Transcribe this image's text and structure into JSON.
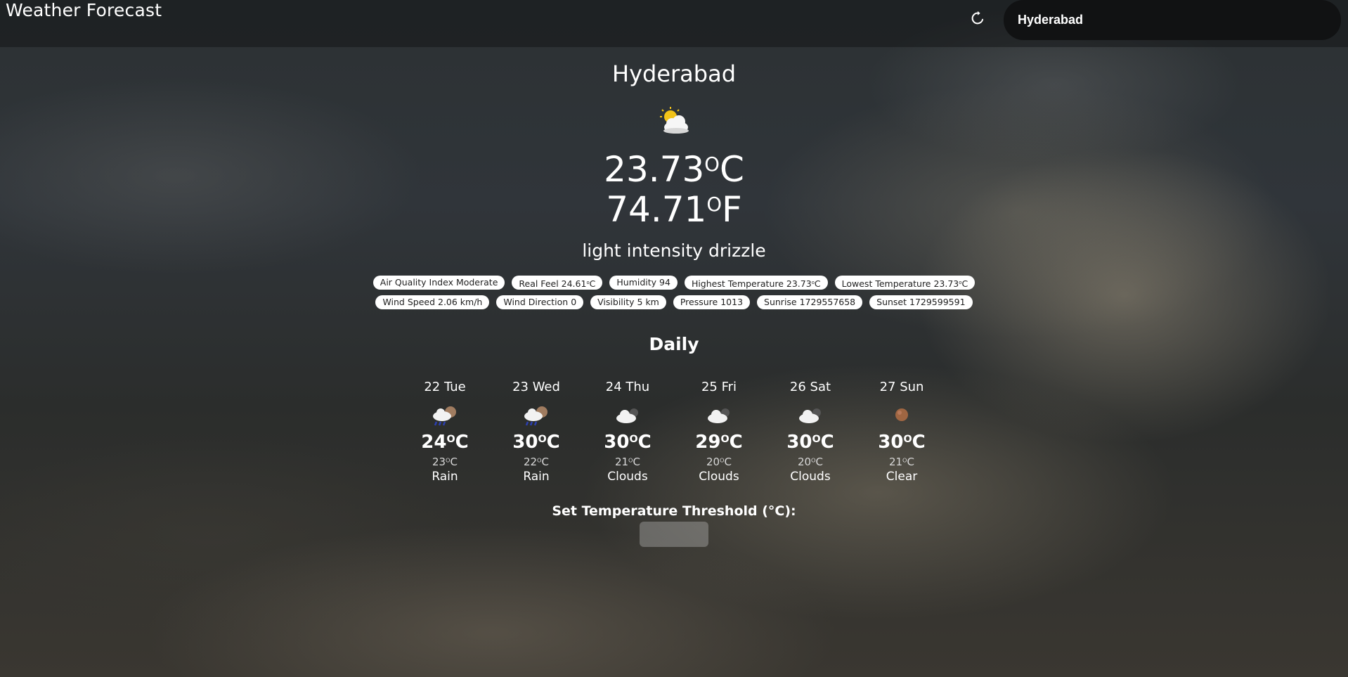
{
  "header": {
    "title": "Weather Forecast",
    "refresh_icon": "refresh-icon",
    "search_value": "Hyderabad"
  },
  "current": {
    "city": "Hyderabad",
    "icon": "partly-cloudy-sun-icon",
    "temp_c": "23.73",
    "temp_f": "74.71",
    "unit_c": "C",
    "unit_f": "F",
    "description": "light intensity drizzle"
  },
  "details_row1": [
    {
      "label": "Air Quality Index Moderate"
    },
    {
      "label": "Real Feel 24.61",
      "unit": "C"
    },
    {
      "label": "Humidity 94"
    },
    {
      "label": "Highest Temperature 23.73",
      "unit": "C"
    },
    {
      "label": "Lowest Temperature 23.73",
      "unit": "C"
    }
  ],
  "details_row2": [
    {
      "label": "Wind Speed 2.06 km/h"
    },
    {
      "label": "Wind Direction 0"
    },
    {
      "label": "Visibility 5 km"
    },
    {
      "label": "Pressure 1013"
    },
    {
      "label": "Sunrise 1729557658"
    },
    {
      "label": "Sunset 1729599591"
    }
  ],
  "daily": {
    "title": "Daily",
    "days": [
      {
        "name": "22 Tue",
        "icon": "rain-night-icon",
        "max": "24",
        "min": "23",
        "condition": "Rain"
      },
      {
        "name": "23 Wed",
        "icon": "rain-night-icon",
        "max": "30",
        "min": "22",
        "condition": "Rain"
      },
      {
        "name": "24 Thu",
        "icon": "cloud-night-icon",
        "max": "30",
        "min": "21",
        "condition": "Clouds"
      },
      {
        "name": "25 Fri",
        "icon": "cloud-night-icon",
        "max": "29",
        "min": "20",
        "condition": "Clouds"
      },
      {
        "name": "26 Sat",
        "icon": "cloud-night-icon",
        "max": "30",
        "min": "20",
        "condition": "Clouds"
      },
      {
        "name": "27 Sun",
        "icon": "moon-icon",
        "max": "30",
        "min": "21",
        "condition": "Clear"
      }
    ]
  },
  "threshold": {
    "label": "Set Temperature Threshold (°C):",
    "value": ""
  },
  "colors": {
    "chip_bg": "#ffffff",
    "search_bg": "#111213",
    "topbar_bg": "rgba(20,22,24,0.55)"
  }
}
